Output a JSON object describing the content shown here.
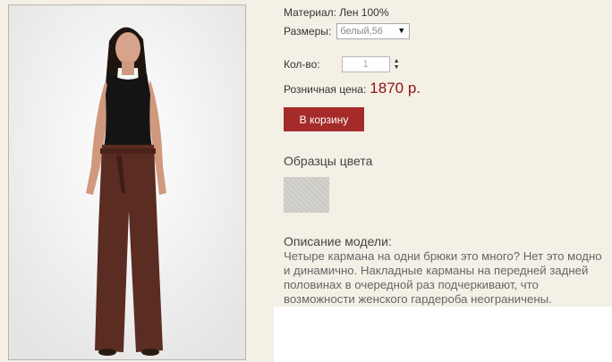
{
  "product": {
    "material": "Материал: Лен 100%",
    "sizes_label": "Размеры:",
    "size_selected": "белый,56",
    "qty_label": "Кол-во:",
    "qty_value": "1",
    "price_label": "Розничная цена:",
    "price_value": "1870 р.",
    "cart_button": "В корзину"
  },
  "colors": {
    "title": "Образцы цвета",
    "accent": "#a52a2a",
    "price": "#8a1416"
  },
  "description": {
    "title": "Описание модели:",
    "text": "Четыре кармана на одни брюки это много? Нет это модно и динамично. Накладные карманы на передней задней половинах в очередной раз подчеркивают, что возможности женского гардероба неограничены."
  },
  "icons": {
    "select_arrow": "triangle-down",
    "stepper": "up-down-arrows"
  }
}
